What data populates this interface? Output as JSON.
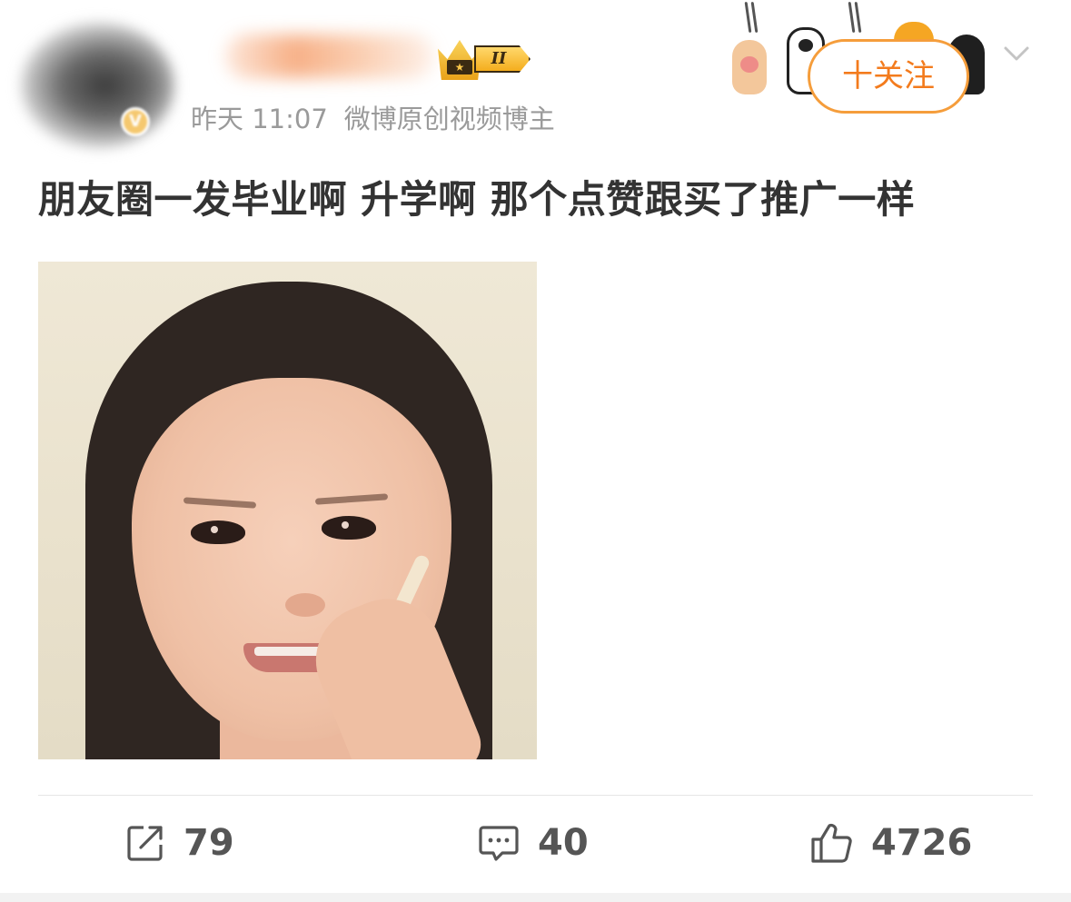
{
  "post": {
    "timestamp": "昨天 11:07",
    "source": "微博原创视频博主",
    "text": "朋友圈一发毕业啊 升学啊 那个点赞跟买了推广一样"
  },
  "vip": {
    "level": "II"
  },
  "follow_button": {
    "label": "十关注"
  },
  "actions": {
    "repost": {
      "count": "79",
      "icon": "repost-icon"
    },
    "comment": {
      "count": "40",
      "icon": "comment-icon"
    },
    "like": {
      "count": "4726",
      "icon": "thumbs-up-icon"
    }
  },
  "colors": {
    "accent_orange": "#f37b1d",
    "follow_border": "#f59d3b",
    "meta_gray": "#9a9a9a",
    "text_dark": "#333333"
  }
}
